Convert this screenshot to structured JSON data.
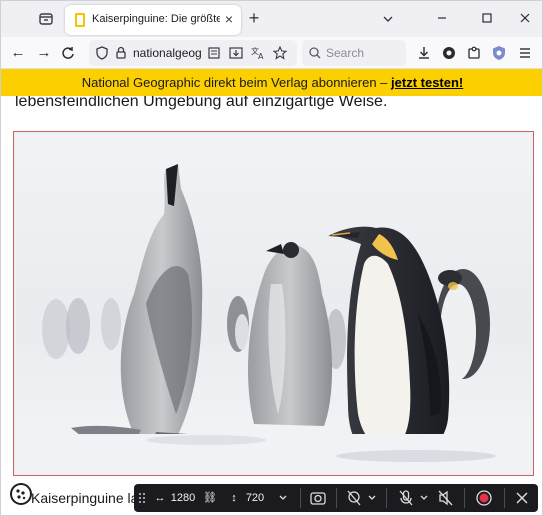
{
  "browser": {
    "tab": {
      "title": "Kaiserpinguine: Die größten Dra"
    },
    "url": "nationalgeog",
    "search_placeholder": "Search"
  },
  "banner": {
    "text": "National Geographic direkt beim Verlag abonnieren – ",
    "link": "jetzt testen!"
  },
  "article": {
    "text_line": "lebensfeindlichen Umgebung auf einzigartige Weise.",
    "caption": "Kaiserpinguine la"
  },
  "recorder": {
    "width": "1280",
    "height": "720"
  },
  "colors": {
    "banner_bg": "#fccf00",
    "frame_border": "#c86464",
    "recorder_bg": "#1b1b1f",
    "record_dot": "#e8304a"
  }
}
